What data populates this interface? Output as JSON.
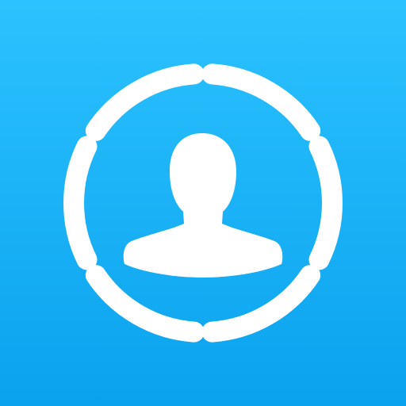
{
  "app_icon": {
    "icon": "user-progress-ring-icon",
    "colors": {
      "background_top": "#2cc2ff",
      "background_bottom": "#0aa2ee",
      "foreground": "#ffffff"
    },
    "ring": {
      "segments": 6,
      "filled_segments": 6
    }
  }
}
